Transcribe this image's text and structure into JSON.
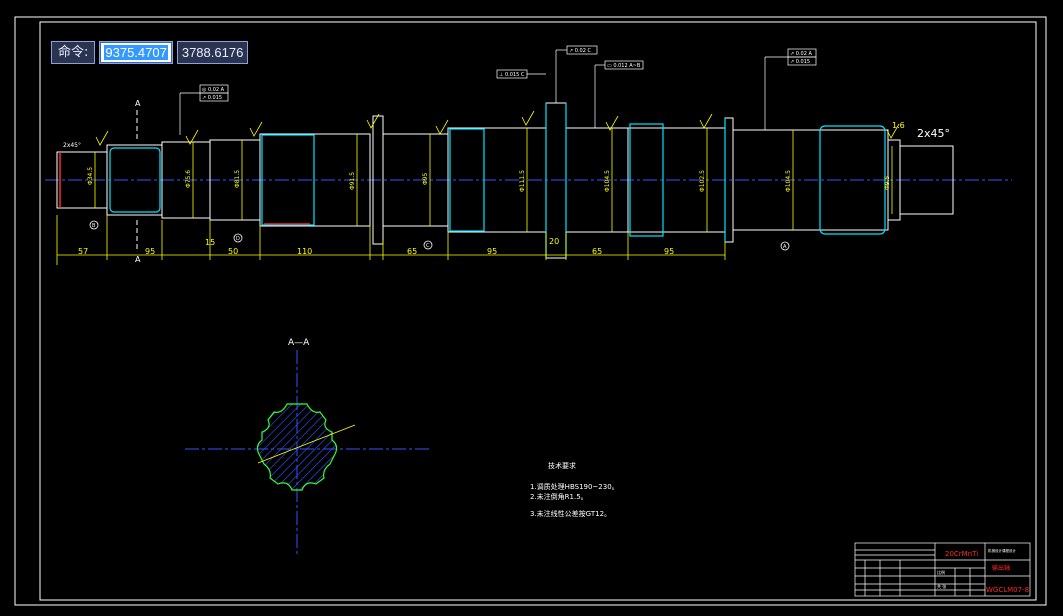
{
  "command_bar": {
    "label": "命令:",
    "x_value": "9375.4707",
    "y_value": "3788.6176"
  },
  "drawing": {
    "top_dims": [
      "57",
      "95",
      "15",
      "50",
      "110",
      "65",
      "95",
      "20",
      "65",
      "95"
    ],
    "chamfer_right": "2x45°",
    "chamfer_left": "2x45°",
    "section_mark": "A",
    "section_title": "A—A",
    "roughness_right": "1.6",
    "tol_frame_1": "◎ 0.02 A",
    "tol_frame_2": "↗ 0.015",
    "tol_frame_3": "↗ 0.02 C",
    "tol_frame_4": "▭ 0.012 A~B",
    "tol_frame_5": "⊥ 0.015 C",
    "tol_frame_6": "↗ 0.02 A",
    "tol_frame_7": "↗ 0.015",
    "datum_B": "B",
    "datum_D": "D",
    "datum_C": "C",
    "datum_A": "A",
    "tech_title": "技术要求",
    "tech_lines": [
      "1.调质处理HBS190~230。",
      "2.未注倒角R1.5。",
      "3.未注线性公差按GT12。"
    ]
  },
  "title_block": {
    "material": "20CrMnTi",
    "part_name": "输出轴",
    "drawing_no": "WGCLM07-8",
    "org": "机械设计课程设计",
    "scale_label": "比例",
    "sheet": "共 张"
  },
  "colors": {
    "frame": "#ffffff",
    "dims": "#ffff00",
    "centerline": "#3355ff",
    "outline": "#ffffff",
    "cyan": "#00e5ff",
    "red": "#ff2a2a",
    "green": "#33ff33"
  }
}
